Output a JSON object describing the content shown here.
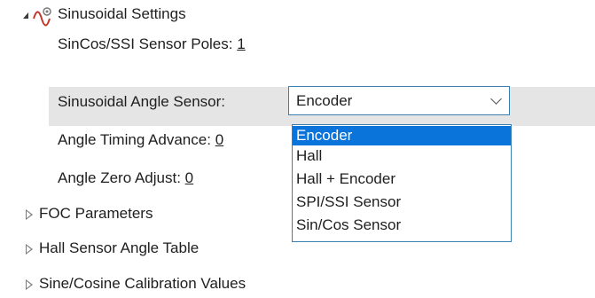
{
  "tree": {
    "group_title": "Sinusoidal Settings",
    "items": [
      {
        "label": "SinCos/SSI Sensor Poles:",
        "value": "1"
      },
      {
        "label": "Sinusoidal Angle Sensor:",
        "value": "Encoder"
      },
      {
        "label": "Angle Timing Advance:",
        "value": "0"
      },
      {
        "label": "Angle Zero Adjust:",
        "value": "0"
      }
    ],
    "collapsed_groups": [
      "FOC Parameters",
      "Hall Sensor Angle Table",
      "Sine/Cosine Calibration Values"
    ]
  },
  "dropdown": {
    "options": [
      "Encoder",
      "Hall",
      "Hall + Encoder",
      "SPI/SSI Sensor",
      "Sin/Cos Sensor"
    ],
    "selected": "Encoder"
  },
  "icons": {
    "group_icon": "sine-wave-settings-icon",
    "expand_open": "expanded-triangle-icon",
    "expand_closed": "collapsed-triangle-icon",
    "combo_arrow": "chevron-down-icon"
  },
  "colors": {
    "selection_blue": "#0a74da",
    "border_blue": "#3c7fb1",
    "row_highlight": "#e5e5e5"
  }
}
